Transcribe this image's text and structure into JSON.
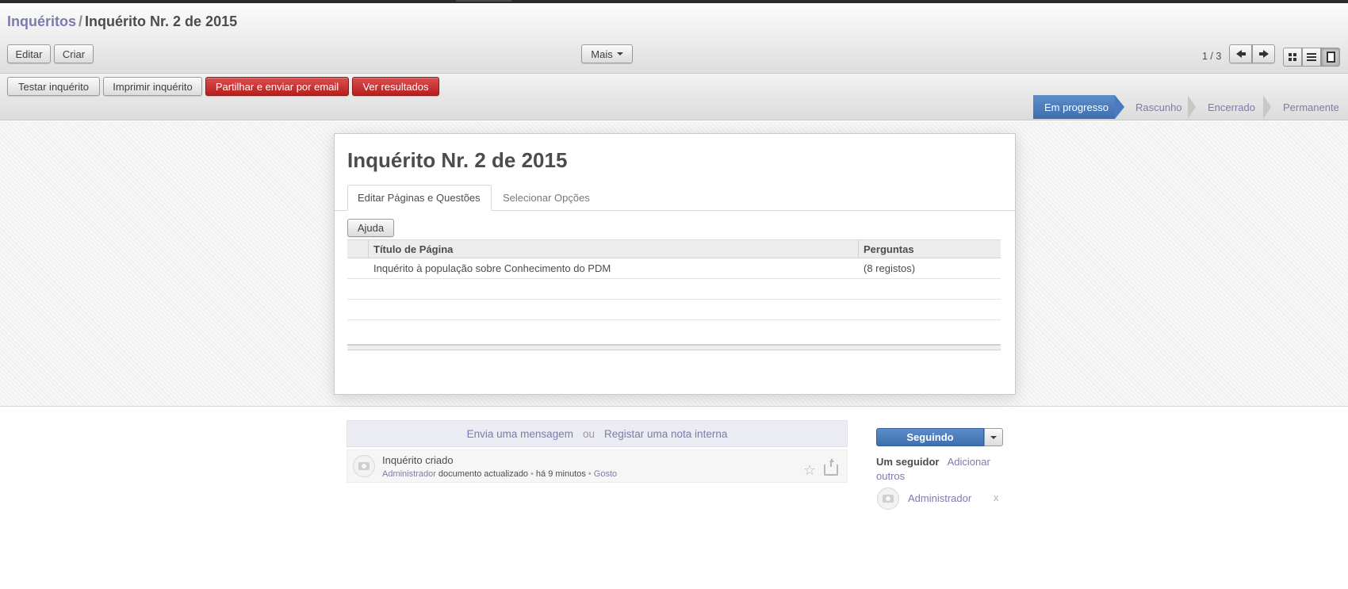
{
  "breadcrumb": {
    "parent": "Inquéritos",
    "separator": "/",
    "current": "Inquérito Nr. 2 de 2015"
  },
  "toolbar": {
    "edit": "Editar",
    "create": "Criar",
    "more": "Mais"
  },
  "pager": {
    "value": "1 / 3"
  },
  "header_buttons": {
    "test": "Testar inquérito",
    "print": "Imprimir inquérito",
    "share": "Partilhar e enviar por email",
    "results": "Ver resultados"
  },
  "statusbar": {
    "steps": [
      "Em progresso",
      "Rascunho",
      "Encerrado",
      "Permanente"
    ],
    "active": "Em progresso"
  },
  "form": {
    "title": "Inquérito Nr. 2 de 2015",
    "tabs": [
      "Editar Páginas e Questões",
      "Selecionar Opções"
    ],
    "help_button": "Ajuda",
    "table": {
      "columns": [
        "Título de Página",
        "Perguntas"
      ],
      "rows": [
        [
          "Inquérito à população sobre Conhecimento do PDM",
          "(8 registos)"
        ]
      ]
    }
  },
  "chatter": {
    "send_message": "Envia uma mensagem",
    "or": "ou",
    "log_note": "Registar uma nota interna",
    "message": {
      "title": "Inquérito criado",
      "author": "Administrador",
      "action": "documento actualizado",
      "time": "há 9 minutos",
      "like": "Gosto"
    }
  },
  "followers": {
    "button": "Seguindo",
    "count": "Um seguidor",
    "add_others": "Adicionar outros",
    "list": [
      "Administrador"
    ],
    "remove": "x"
  },
  "colors": {
    "accent": "#7c7bad",
    "status_active": "#4a7bbf",
    "danger": "#c62b2b"
  }
}
